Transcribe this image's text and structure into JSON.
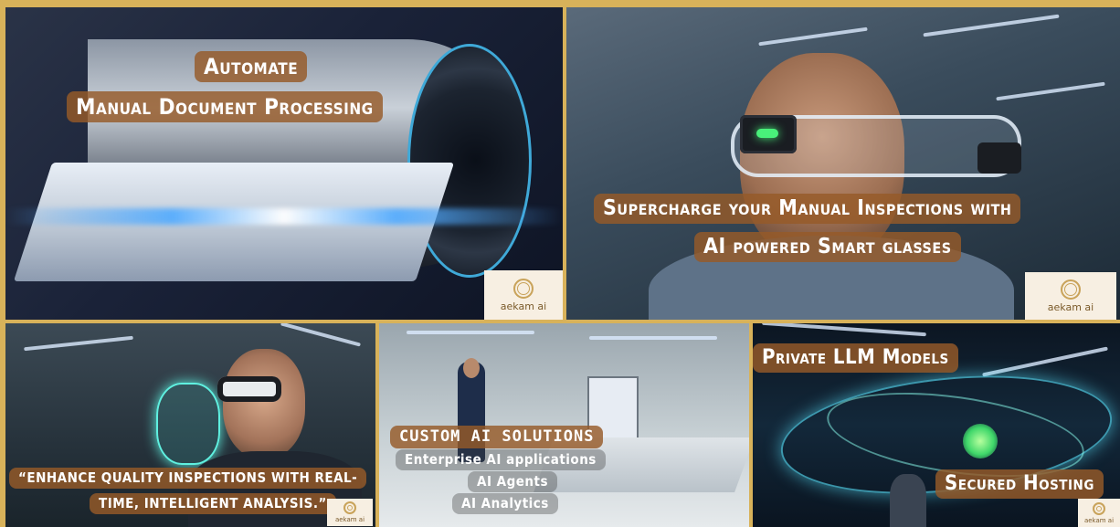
{
  "tiles": [
    {
      "title_line1": "Automate",
      "title_line2": "Manual Document Processing"
    },
    {
      "title_line1": "Supercharge your Manual Inspections with",
      "title_line2": "AI powered Smart glasses"
    },
    {
      "title_line1": "“ENHANCE QUALITY INSPECTIONS WITH REAL-",
      "title_line2": "TIME, INTELLIGENT ANALYSIS.”"
    },
    {
      "heading": "CUSTOM AI SOLUTIONS",
      "items": [
        "Enterprise AI applications",
        "AI Agents",
        "AI Analytics"
      ]
    },
    {
      "top_label": "Private LLM Models",
      "bottom_label": "Secured Hosting"
    }
  ],
  "brand": {
    "logo_text": "aekam ai"
  }
}
